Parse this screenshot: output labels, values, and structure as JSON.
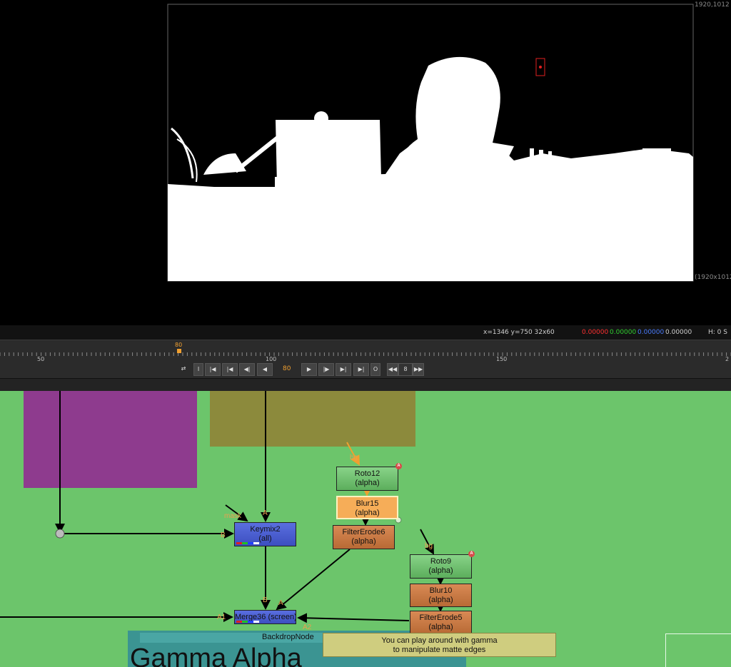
{
  "viewer": {
    "format_top_right": "1920,1012",
    "format_bottom_right": "(1920x1012"
  },
  "status": {
    "coords": "x=1346 y=750 32x60",
    "r": "0.00000",
    "g": "0.00000",
    "b": "0.00000",
    "a": "0.00000",
    "hsv": "H:  0 S",
    "colors": {
      "r": "#ff3030",
      "g": "#30d030",
      "b": "#4a7cff",
      "a": "#e0e0e0"
    }
  },
  "timeline": {
    "current_frame_marker": "80",
    "ticks": [
      "50",
      "100",
      "150",
      "2"
    ],
    "current_frame": "80",
    "increment": "8",
    "buttons": [
      "⇄",
      "I",
      "|◀",
      "|◀",
      "◀|",
      "◀",
      "▶",
      "|▶",
      "▶|",
      "▶|",
      "O",
      "◀◀",
      "▶▶"
    ]
  },
  "graph": {
    "nodes": {
      "roto12": {
        "l1": "Roto12",
        "l2": "(alpha)"
      },
      "blur15": {
        "l1": "Blur15",
        "l2": "(alpha)"
      },
      "filtererode6": {
        "l1": "FilterErode6",
        "l2": "(alpha)"
      },
      "keymix2": {
        "l1": "Keymix2",
        "l2": "(all)"
      },
      "roto9": {
        "l1": "Roto9",
        "l2": "(alpha)"
      },
      "blur10": {
        "l1": "Blur10",
        "l2": "(alpha)"
      },
      "filtererode5": {
        "l1": "FilterErode5",
        "l2": "(alpha)"
      },
      "merge36": {
        "l1": "Merge36 (screen)"
      }
    },
    "pins": {
      "bg1": "bg",
      "bg2": "bg",
      "mask": "mask",
      "a_keymix": "A",
      "b_keymix": "B",
      "b_merge": "B",
      "a_merge": "A",
      "a1": "A1",
      "a2": "A2"
    },
    "badges": {
      "roto12": "A",
      "roto9": "A"
    },
    "backdrop_label": "BackdropNode",
    "backdrop_title": "Gamma Alpha",
    "sticky_note": {
      "line1": "You can play around with gamma",
      "line2": "to manipulate matte edges"
    }
  }
}
